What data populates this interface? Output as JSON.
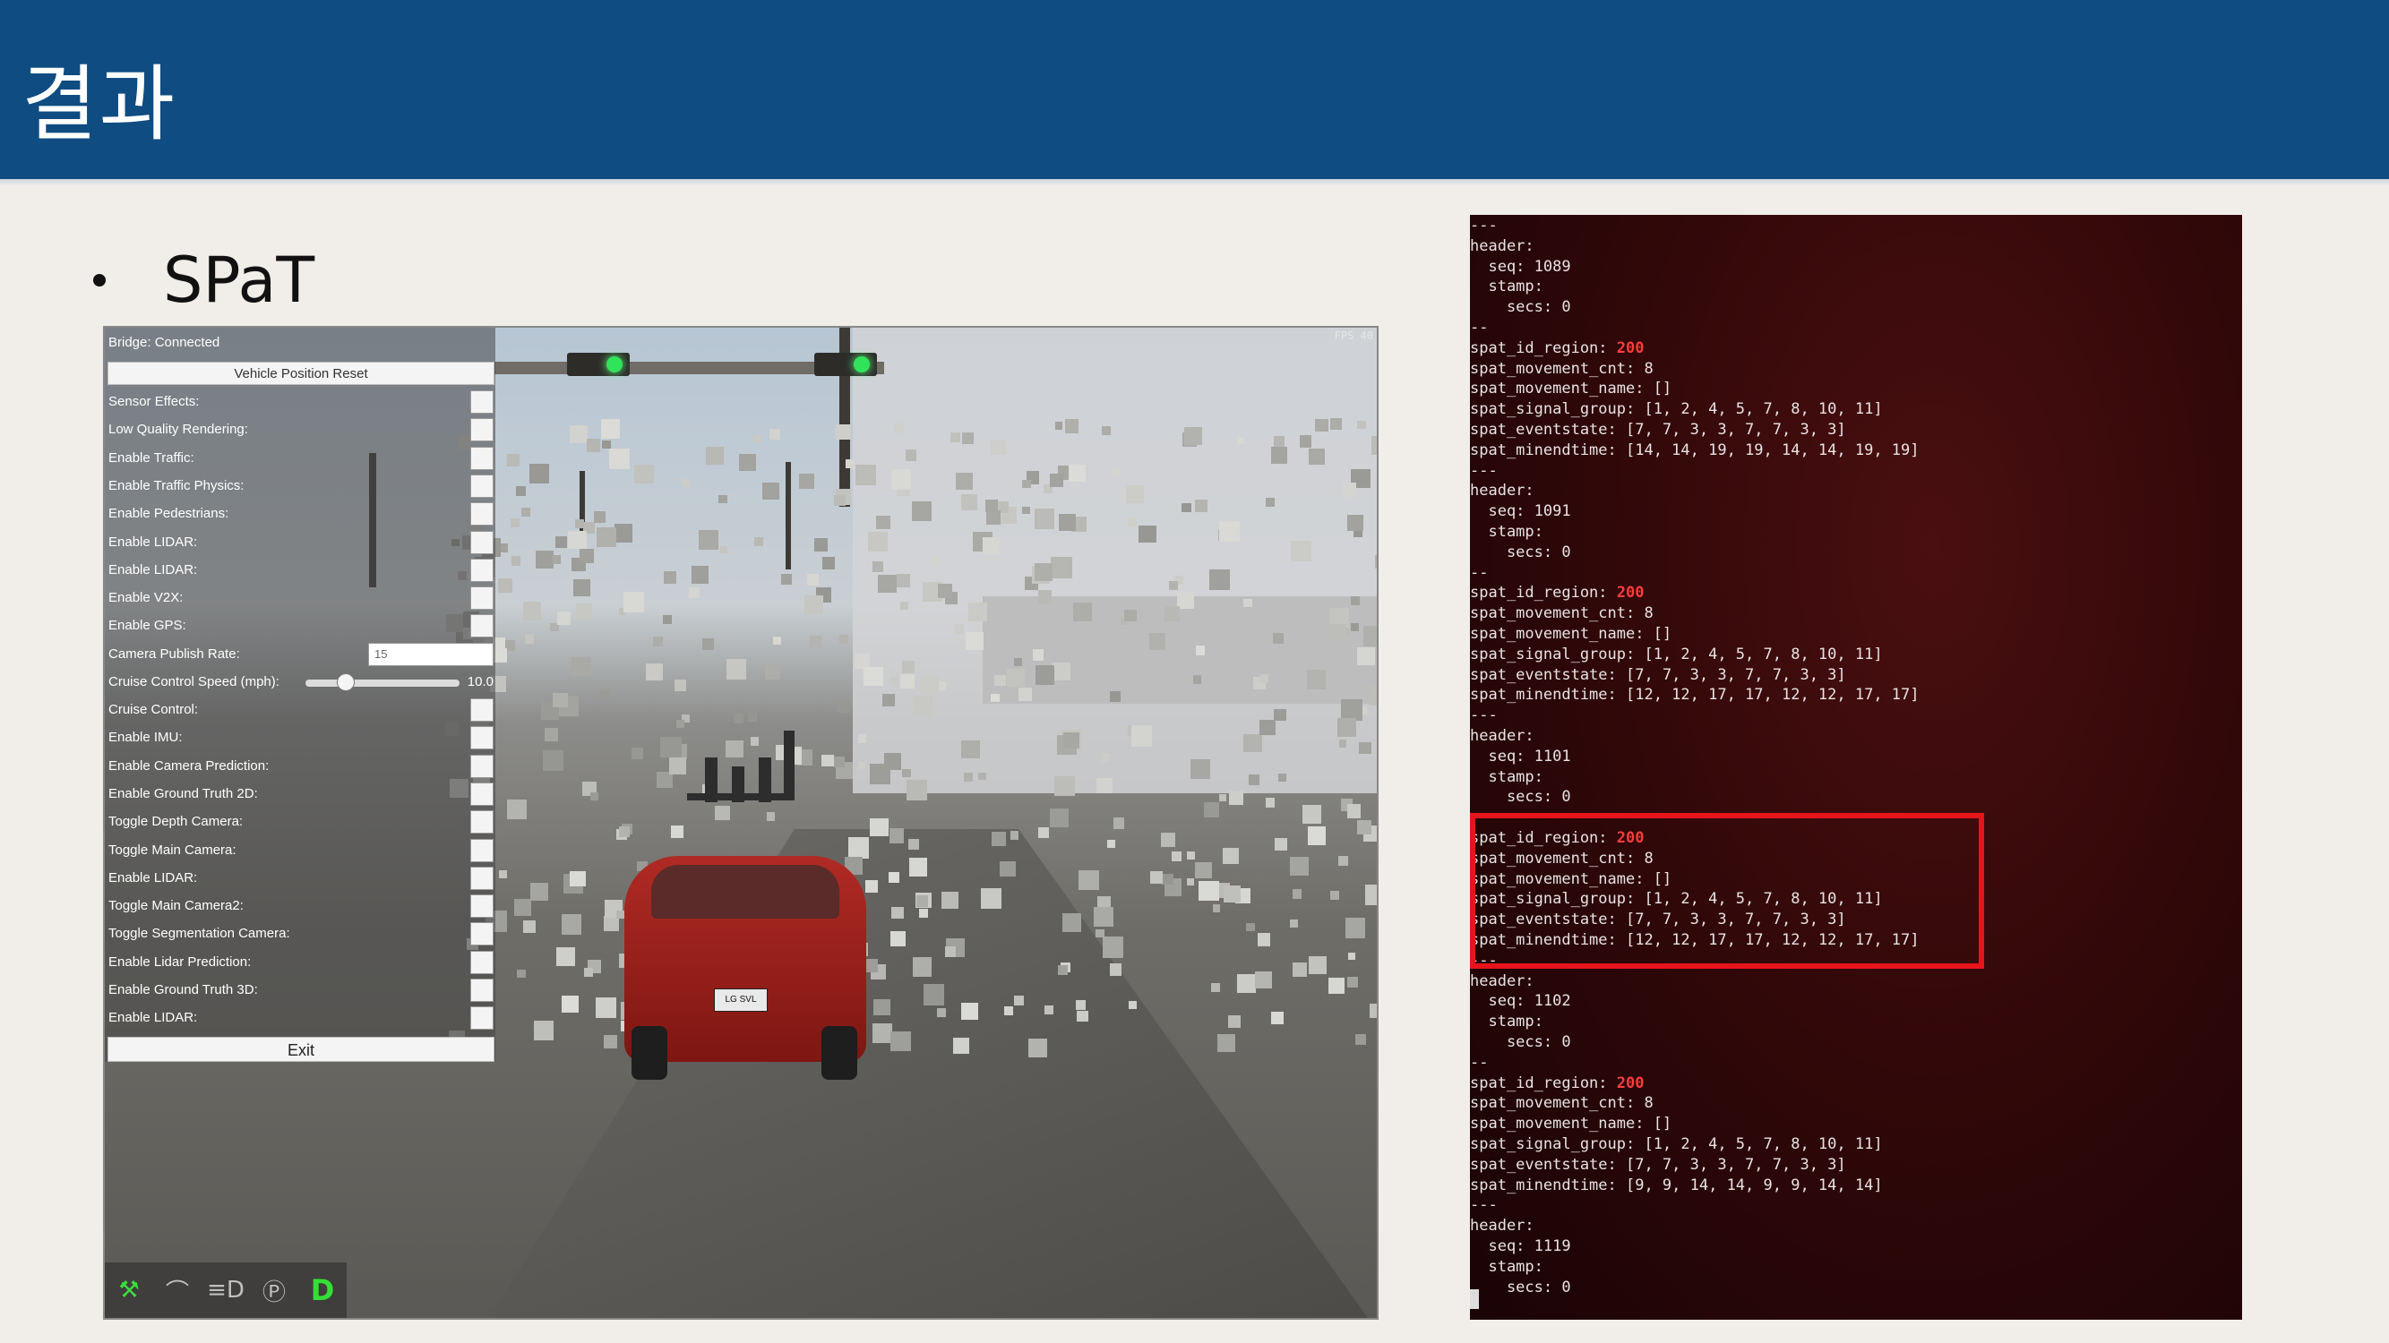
{
  "slide": {
    "title": "결과",
    "bullet": "SPaT"
  },
  "simulator": {
    "bridge_status": "Bridge:  Connected",
    "fps_label": "FPS 40",
    "reset_button": "Vehicle Position Reset",
    "options": [
      {
        "label": "Sensor Effects:"
      },
      {
        "label": "Low Quality Rendering:"
      },
      {
        "label": "Enable Traffic:"
      },
      {
        "label": "Enable Traffic Physics:"
      },
      {
        "label": "Enable Pedestrians:"
      },
      {
        "label": "Enable LIDAR:"
      },
      {
        "label": "Enable LIDAR:"
      },
      {
        "label": "Enable V2X:"
      },
      {
        "label": "Enable GPS:"
      }
    ],
    "camera_publish_rate": {
      "label": "Camera Publish Rate:",
      "value": "15"
    },
    "cruise_speed": {
      "label": "Cruise Control Speed (mph):",
      "value": "10.0",
      "level": 0.25
    },
    "options2": [
      {
        "label": "Cruise Control:"
      },
      {
        "label": "Enable IMU:"
      },
      {
        "label": "Enable Camera Prediction:"
      },
      {
        "label": "Enable Ground Truth 2D:"
      },
      {
        "label": "Toggle Depth Camera:"
      },
      {
        "label": "Toggle Main Camera:"
      },
      {
        "label": "Enable LIDAR:"
      },
      {
        "label": "Toggle Main Camera2:"
      },
      {
        "label": "Toggle Segmentation Camera:"
      },
      {
        "label": "Enable Lidar Prediction:"
      },
      {
        "label": "Enable Ground Truth 3D:"
      },
      {
        "label": "Enable LIDAR:"
      }
    ],
    "exit_button": "Exit",
    "plate": "LG SVL",
    "toolbar": {
      "icons": [
        "wrench-icon",
        "wiper-icon",
        "headlight-icon",
        "parking-brake-icon"
      ],
      "icon_glyphs": [
        "⚒",
        "⌒",
        "≡D",
        "Ⓟ"
      ],
      "gear": "D",
      "accent_color": "#35e035"
    }
  },
  "terminal": {
    "lines": [
      "---",
      "header:",
      "  seq: 1089",
      "  stamp:",
      "    secs: 0",
      "--",
      "spat_id_region: |200",
      "spat_movement_cnt: 8",
      "spat_movement_name: []",
      "spat_signal_group: [1, 2, 4, 5, 7, 8, 10, 11]",
      "spat_eventstate: [7, 7, 3, 3, 7, 7, 3, 3]",
      "spat_minendtime: [14, 14, 19, 19, 14, 14, 19, 19]",
      "---",
      "header:",
      "  seq: 1091",
      "  stamp:",
      "    secs: 0",
      "--",
      "spat_id_region: |200",
      "spat_movement_cnt: 8",
      "spat_movement_name: []",
      "spat_signal_group: [1, 2, 4, 5, 7, 8, 10, 11]",
      "spat_eventstate: [7, 7, 3, 3, 7, 7, 3, 3]",
      "spat_minendtime: [12, 12, 17, 17, 12, 12, 17, 17]",
      "---",
      "header:",
      "  seq: 1101",
      "  stamp:",
      "    secs: 0",
      "--",
      "spat_id_region: |200",
      "spat_movement_cnt: 8",
      "spat_movement_name: []",
      "spat_signal_group: [1, 2, 4, 5, 7, 8, 10, 11]",
      "spat_eventstate: [7, 7, 3, 3, 7, 7, 3, 3]",
      "spat_minendtime: [12, 12, 17, 17, 12, 12, 17, 17]",
      "---",
      "header:",
      "  seq: 1102",
      "  stamp:",
      "    secs: 0",
      "--",
      "spat_id_region: |200",
      "spat_movement_cnt: 8",
      "spat_movement_name: []",
      "spat_signal_group: [1, 2, 4, 5, 7, 8, 10, 11]",
      "spat_eventstate: [7, 7, 3, 3, 7, 7, 3, 3]",
      "spat_minendtime: [9, 9, 14, 14, 9, 9, 14, 14]",
      "---",
      "header:",
      "  seq: 1119",
      "  stamp:",
      "    secs: 0"
    ],
    "highlight_color": "#e8141b",
    "number_color": "#ff3b3b"
  }
}
